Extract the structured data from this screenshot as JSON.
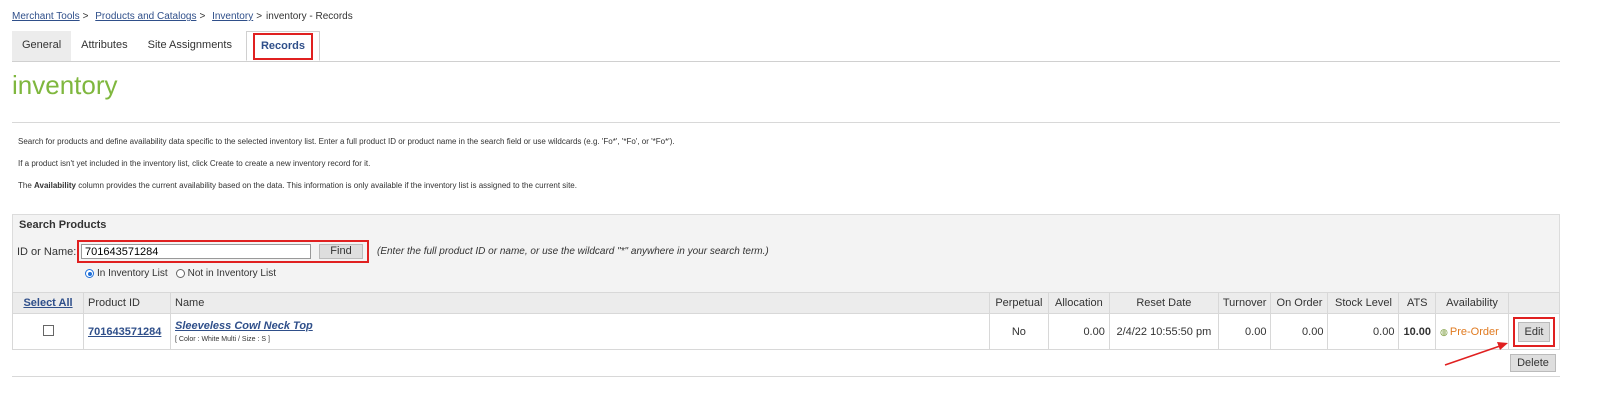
{
  "breadcrumb": {
    "items": [
      "Merchant Tools",
      "Products and Catalogs",
      "Inventory"
    ],
    "current": "inventory - Records",
    "separator": ">"
  },
  "tabs": [
    "General",
    "Attributes",
    "Site Assignments",
    "Records"
  ],
  "active_tab": "Records",
  "page_title": "inventory",
  "help": {
    "line1": "Search for products and define availability data specific to the selected inventory list. Enter a full product ID or product name in the search field or use wildcards (e.g. 'Fo*', '*Fo', or '*Fo*').",
    "line2_a": "If a product isn't yet included in the inventory list, click ",
    "line2_b": "Create",
    "line2_c": " to create a new inventory record for it.",
    "line3_a": "The ",
    "line3_b": "Availability",
    "line3_c": " column provides the current availability based on the data. This information is only available if the inventory list is assigned to the current site."
  },
  "search": {
    "title": "Search Products",
    "label": "ID or Name:",
    "value": "701643571284",
    "find_label": "Find",
    "hint": "(Enter the full product ID or name, or use the wildcard \"*\" anywhere in your search term.)",
    "radio_in": "In Inventory List",
    "radio_not": "Not in Inventory List",
    "selected": "In Inventory List"
  },
  "table": {
    "columns": [
      "Select All",
      "Product ID",
      "Name",
      "Perpetual",
      "Allocation",
      "Reset Date",
      "Turnover",
      "On Order",
      "Stock Level",
      "ATS",
      "Availability",
      ""
    ],
    "rows": [
      {
        "product_id": "701643571284",
        "name": "Sleeveless Cowl Neck Top",
        "variant": "[ Color : White Multi / Size : S ]",
        "perpetual": "No",
        "allocation": "0.00",
        "reset_date": "2/4/22 10:55:50 pm",
        "turnover": "0.00",
        "on_order": "0.00",
        "stock_level": "0.00",
        "ats": "10.00",
        "availability": "Pre-Order",
        "edit_label": "Edit"
      }
    ]
  },
  "delete_label": "Delete",
  "colors": {
    "title_green": "#7fb73e",
    "link_blue": "#2f4f8a",
    "highlight_red": "#e02020",
    "preorder_orange": "#e07a20"
  }
}
